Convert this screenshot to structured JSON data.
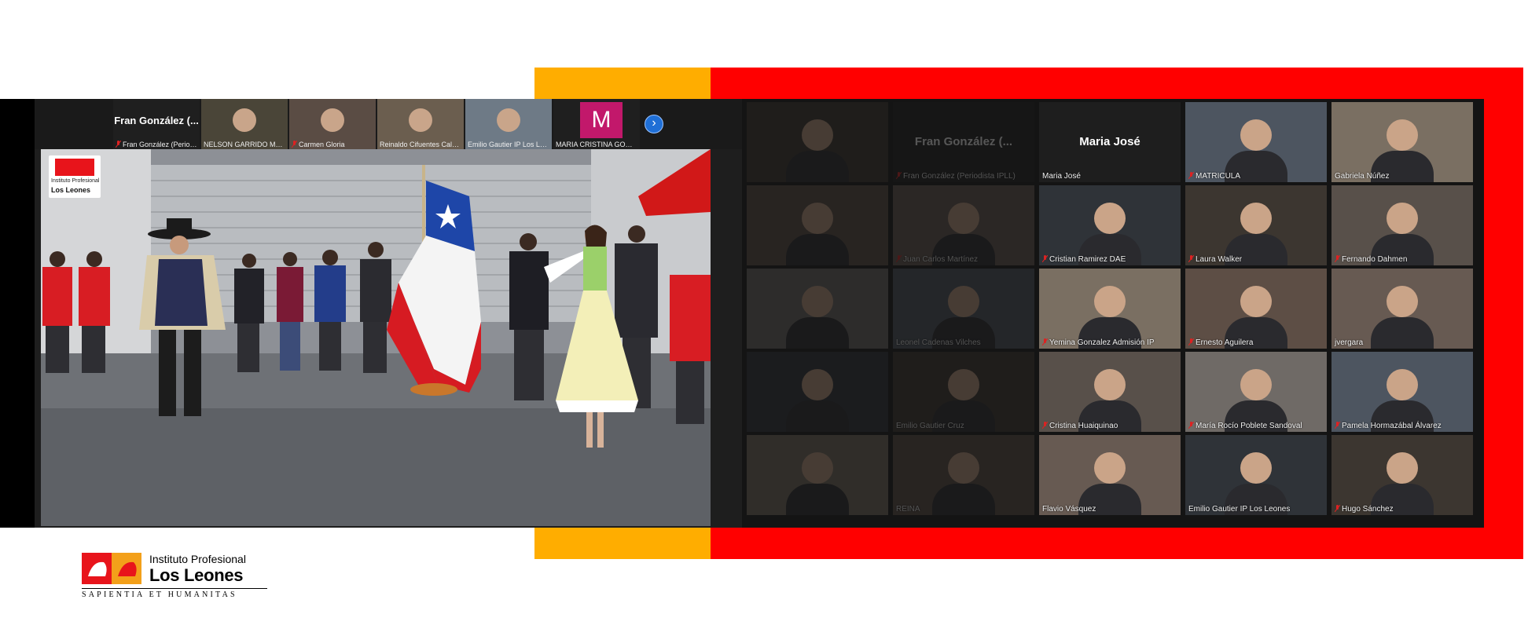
{
  "colors": {
    "orange": "#ffad00",
    "red": "#ff0000",
    "zoom_dark": "#1e1e1e",
    "gallery_dark": "#141414",
    "brand_red": "#e8141b",
    "nav_blue": "#1f6fd6"
  },
  "filmstrip": {
    "tiles": [
      {
        "name": "Fran González (Periodi...",
        "big_label": "Fran González (...",
        "muted": true
      },
      {
        "name": "NELSON GARRIDO MOR...",
        "muted": false
      },
      {
        "name": "Carmen Gloria",
        "muted": true
      },
      {
        "name": "Reinaldo Cifuentes Calder...",
        "muted": false
      },
      {
        "name": "Emilio Gautier IP Los Leone...",
        "muted": false
      },
      {
        "name": "MARIA CRISTINA GOMEZ ...",
        "avatar_letter": "M",
        "muted": false
      }
    ],
    "next_icon": "chevron-right-icon"
  },
  "shared_screen": {
    "logo_lines": [
      "Instituto Profesional",
      "Los Leones"
    ]
  },
  "gallery": {
    "rows": [
      [
        {
          "name": "",
          "dim": true
        },
        {
          "name": "Fran González (Periodista IPLL)",
          "big_label": "Fran González (...",
          "dim": true,
          "muted": true
        },
        {
          "name": "Maria José",
          "big_label": "Maria José",
          "muted": false
        },
        {
          "name": "MATRICULA",
          "muted": true
        },
        {
          "name": "Gabriela Núñez",
          "muted": false
        }
      ],
      [
        {
          "name": "",
          "dim": true
        },
        {
          "name": "Juan Carlos Martínez",
          "dim": true,
          "muted": true
        },
        {
          "name": "Cristian Ramirez DAE",
          "muted": true
        },
        {
          "name": "Laura Walker",
          "muted": true
        },
        {
          "name": "Fernando Dahmen",
          "muted": true
        }
      ],
      [
        {
          "name": "",
          "dim": true
        },
        {
          "name": "Leonel Cadenas Vilches",
          "dim": true,
          "muted": false
        },
        {
          "name": "Yemina Gonzalez Admisión IP",
          "muted": true
        },
        {
          "name": "Ernesto Aguilera",
          "muted": true
        },
        {
          "name": "jvergara",
          "muted": false
        }
      ],
      [
        {
          "name": "",
          "dim": true
        },
        {
          "name": "Emilio Gautier Cruz",
          "dim": true,
          "muted": false
        },
        {
          "name": "Cristina Huaiquinao",
          "muted": true
        },
        {
          "name": "María Rocío Poblete Sandoval",
          "muted": true
        },
        {
          "name": "Pamela Hormazábal Álvarez",
          "muted": true
        }
      ],
      [
        {
          "name": "",
          "dim": true
        },
        {
          "name": "REINA",
          "dim": true,
          "muted": false
        },
        {
          "name": "Flavio Vásquez",
          "muted": false
        },
        {
          "name": "Emilio Gautier IP Los Leones",
          "muted": false
        },
        {
          "name": "Hugo Sánchez",
          "muted": true
        }
      ]
    ]
  },
  "logo": {
    "line1": "Instituto Profesional",
    "line2": "Los Leones",
    "motto": "SAPIENTIA ET HUMANITAS"
  }
}
